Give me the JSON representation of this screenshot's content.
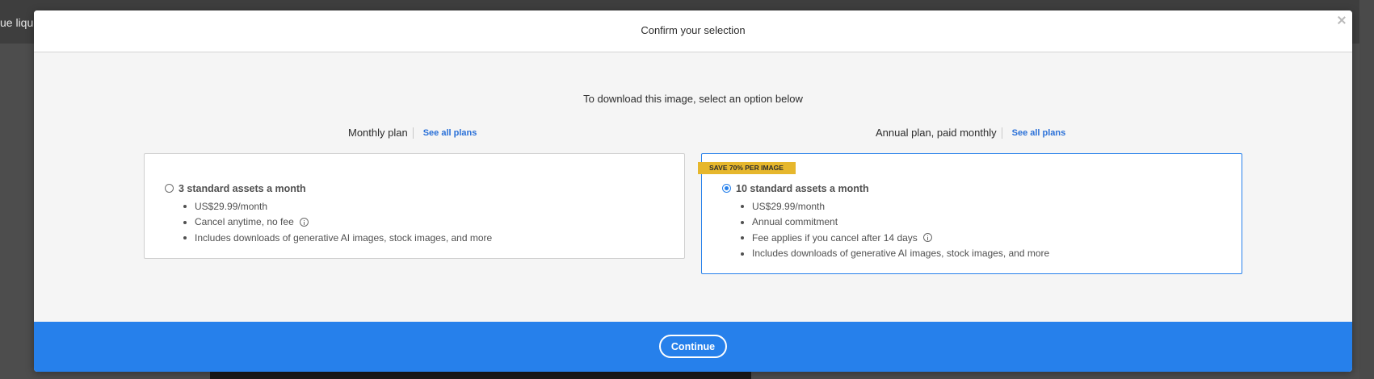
{
  "background": {
    "partial_text": "ue liqui"
  },
  "modal": {
    "title": "Confirm your selection",
    "instruction": "To download this image, select an option below",
    "continue_label": "Continue"
  },
  "monthly": {
    "heading": "Monthly plan",
    "see_all": "See all plans",
    "selected": false,
    "title": "3 standard assets a month",
    "features": [
      "US$29.99/month",
      "Cancel anytime, no fee",
      "Includes downloads of generative AI images, stock images, and more"
    ]
  },
  "annual": {
    "heading": "Annual plan, paid monthly",
    "see_all": "See all plans",
    "badge": "SAVE 70% PER IMAGE",
    "selected": true,
    "title": "10 standard assets a month",
    "features": [
      "US$29.99/month",
      "Annual commitment",
      "Fee applies if you cancel after 14 days",
      "Includes downloads of generative AI images, stock images, and more"
    ]
  },
  "colors": {
    "accent": "#2680eb",
    "link": "#2b71d8",
    "badge": "#e6b72d",
    "overlay": "#4d4d4d"
  }
}
